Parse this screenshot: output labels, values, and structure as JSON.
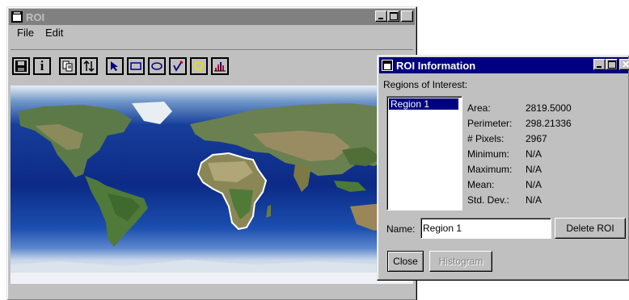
{
  "roi_window": {
    "title": "ROI",
    "menu": [
      "File",
      "Edit"
    ],
    "toolbar": {
      "buttons": [
        "save-icon",
        "info-icon",
        "copy-icon",
        "sort-icon",
        "pointer-arrow-icon",
        "rectangle-icon",
        "ellipse-icon",
        "freehand-icon",
        "polygon-icon",
        "histogram-icon"
      ],
      "info_glyph": "i"
    },
    "map_description": "world map satellite image"
  },
  "info_window": {
    "title": "ROI Information",
    "regions_label": "Regions of Interest:",
    "regions": [
      "Region 1"
    ],
    "selected_region": "Region 1",
    "stats": [
      {
        "label": "Area:",
        "value": "2819.5000"
      },
      {
        "label": "Perimeter:",
        "value": "298.21336"
      },
      {
        "label": "# Pixels:",
        "value": "2967"
      },
      {
        "label": "Minimum:",
        "value": "N/A"
      },
      {
        "label": "Maximum:",
        "value": "N/A"
      },
      {
        "label": "Mean:",
        "value": "N/A"
      },
      {
        "label": "Std. Dev.:",
        "value": "N/A"
      }
    ],
    "name_label": "Name:",
    "name_value": "Region 1",
    "delete_button": "Delete ROI",
    "close_button": "Close",
    "histogram_button": "Histogram"
  },
  "colors": {
    "active_title": "#000080",
    "inactive_title": "#808080",
    "face": "#c0c0c0"
  }
}
